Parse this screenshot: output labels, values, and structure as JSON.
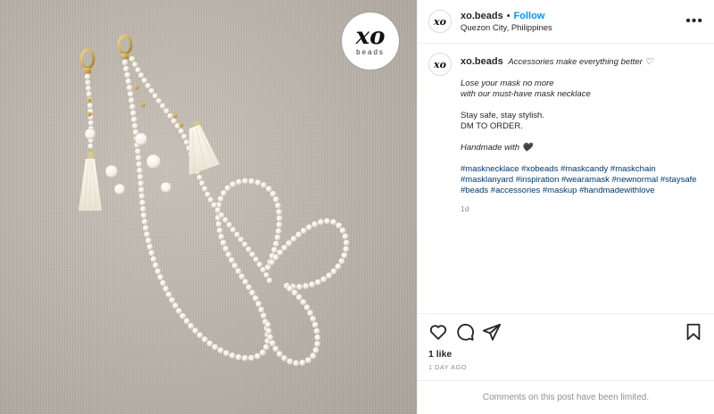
{
  "photo": {
    "logo_mark": "xo",
    "logo_sub": "beads"
  },
  "header": {
    "avatar_text": "xo",
    "username": "xo.beads",
    "separator": "•",
    "follow_label": "Follow",
    "location": "Quezon City, Philippines",
    "more_label": "•••"
  },
  "caption": {
    "avatar_text": "xo",
    "username": "xo.beads",
    "headline": "Accessories make everything better ♡",
    "line1": "Lose your mask no more",
    "line2": "with our must-have mask necklace",
    "line3": "Stay safe, stay stylish.",
    "line4": "DM TO ORDER.",
    "line5": "Handmade with 🖤",
    "hashtags": "#masknecklace #xobeads #maskcandy #maskchain #masklanyard #inspiration #wearamask #newnormal #staysafe #beads #accessories #maskup #handmadewithlove",
    "time": "1d"
  },
  "actions": {
    "like_icon": "heart-icon",
    "comment_icon": "comment-icon",
    "share_icon": "share-icon",
    "save_icon": "bookmark-icon"
  },
  "likes": "1 like",
  "date": "1 DAY AGO",
  "comments_limited": "Comments on this post have been limited."
}
